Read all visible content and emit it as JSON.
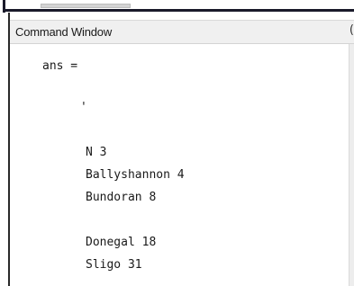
{
  "command_window": {
    "title": "Command Window",
    "header_control_glyph": "(",
    "lines": {
      "ans": "ans =",
      "quote": "'",
      "row1": "N 3",
      "row2": "Ballyshannon 4",
      "row3": "Bundoran 8",
      "row4": "Donegal 18",
      "row5": "Sligo 31"
    }
  }
}
